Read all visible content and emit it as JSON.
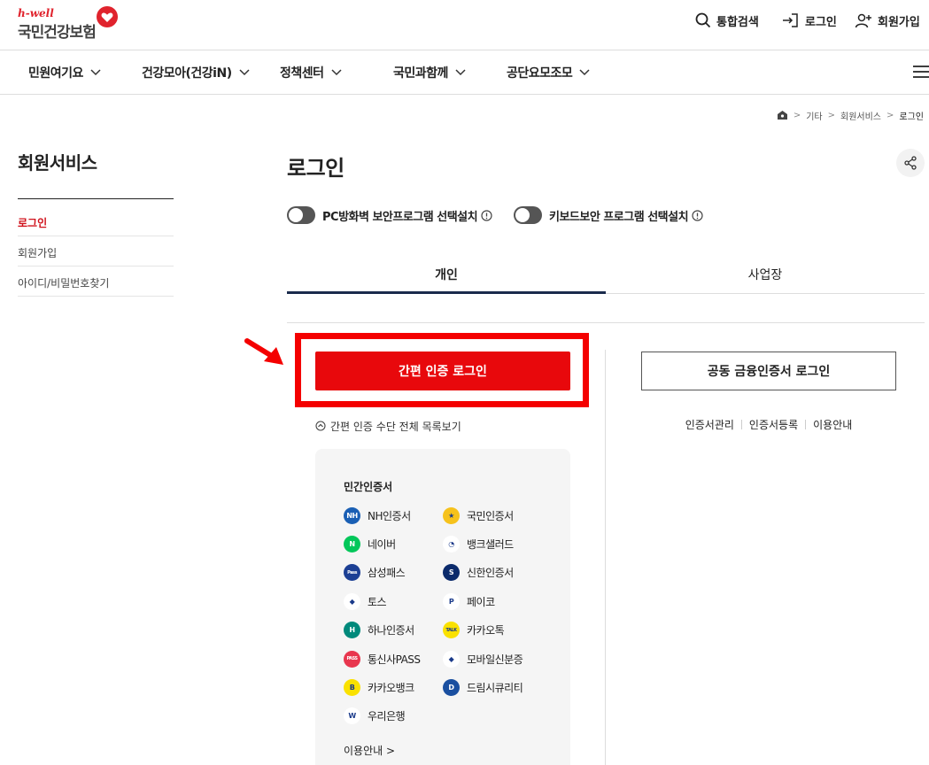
{
  "header": {
    "logo_brand": "h-well",
    "logo_name": "국민건강보험",
    "search_label": "통합검색",
    "login_label": "로그인",
    "join_label": "회원가입"
  },
  "gnb": [
    {
      "label": "민원여기요"
    },
    {
      "label": "건강모아(건강iN)"
    },
    {
      "label": "정책센터"
    },
    {
      "label": "국민과함께"
    },
    {
      "label": "공단요모조모"
    }
  ],
  "breadcrumb": [
    "기타",
    "회원서비스",
    "로그인"
  ],
  "side": {
    "title": "회원서비스",
    "items": [
      {
        "label": "로그인",
        "active": true
      },
      {
        "label": "회원가입"
      },
      {
        "label": "아이디/비밀번호찾기"
      }
    ]
  },
  "main": {
    "title": "로그인",
    "toggles": [
      {
        "label": "PC방화벽 보안프로그램 선택설치"
      },
      {
        "label": "키보드보안 프로그램 선택설치"
      }
    ],
    "tabs": [
      {
        "label": "개인",
        "active": true
      },
      {
        "label": "사업장"
      }
    ],
    "simple_login_label": "간편 인증 로그인",
    "list_toggle_label": "간편 인증 수단 전체 목록보기",
    "auth_box": {
      "title": "민간인증서",
      "items": [
        {
          "label": "NH인증서",
          "color": "#1a5fb4",
          "glyph": "NH"
        },
        {
          "label": "국민인증서",
          "color": "#f6c21c",
          "glyph": "★"
        },
        {
          "label": "네이버",
          "color": "#03c75a",
          "glyph": "N"
        },
        {
          "label": "뱅크샐러드",
          "color": "#ffffff",
          "glyph": "◔"
        },
        {
          "label": "삼성패스",
          "color": "#1c3f94",
          "glyph": "Pass"
        },
        {
          "label": "신한인증서",
          "color": "#0b2a6b",
          "glyph": "S"
        },
        {
          "label": "토스",
          "color": "#ffffff",
          "glyph": "◆"
        },
        {
          "label": "페이코",
          "color": "#ffffff",
          "glyph": "P"
        },
        {
          "label": "하나인증서",
          "color": "#00897b",
          "glyph": "H"
        },
        {
          "label": "카카오톡",
          "color": "#fae100",
          "glyph": "TALK"
        },
        {
          "label": "통신사PASS",
          "color": "#e8364e",
          "glyph": "PASS"
        },
        {
          "label": "모바일신분증",
          "color": "#ffffff",
          "glyph": "◆"
        },
        {
          "label": "카카오뱅크",
          "color": "#fae100",
          "glyph": "B"
        },
        {
          "label": "드림시큐리티",
          "color": "#1a4fa0",
          "glyph": "D"
        },
        {
          "label": "우리은행",
          "color": "#ffffff",
          "glyph": "W"
        }
      ],
      "guide_label": "이용안내 >"
    },
    "cert_login_label": "공동 금융인증서 로그인",
    "cert_links": [
      "인증서관리",
      "인증서등록",
      "이용안내"
    ]
  },
  "colors": {
    "accent_red": "#e8080c",
    "highlight_red": "#f40000",
    "tab_active": "#1a2b4c"
  }
}
